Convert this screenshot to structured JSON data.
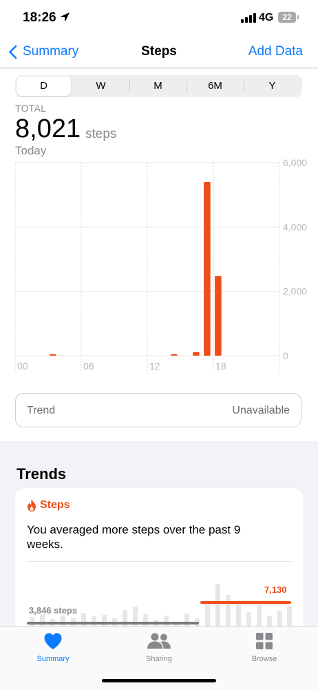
{
  "status": {
    "time": "18:26",
    "network": "4G",
    "battery": "22"
  },
  "nav": {
    "back_label": "Summary",
    "title": "Steps",
    "action_label": "Add Data"
  },
  "range_tabs": [
    {
      "label": "D",
      "selected": true
    },
    {
      "label": "W",
      "selected": false
    },
    {
      "label": "M",
      "selected": false
    },
    {
      "label": "6M",
      "selected": false
    },
    {
      "label": "Y",
      "selected": false
    }
  ],
  "summary": {
    "label": "TOTAL",
    "value": "8,021",
    "unit": "steps",
    "period": "Today"
  },
  "chart_data": {
    "type": "bar",
    "x_ticks": [
      "00",
      "06",
      "12",
      "18"
    ],
    "y_ticks": [
      "6,000",
      "4,000",
      "2,000",
      "0"
    ],
    "ylim": [
      0,
      6000
    ],
    "xlim": [
      0,
      24
    ],
    "bar_color": "#f04e18",
    "bars": [
      {
        "hour": 3,
        "value": 15
      },
      {
        "hour": 14,
        "value": 15
      },
      {
        "hour": 16,
        "value": 110
      },
      {
        "hour": 17,
        "value": 5400
      },
      {
        "hour": 18,
        "value": 2480
      }
    ]
  },
  "trend_row": {
    "label": "Trend",
    "status": "Unavailable"
  },
  "trends": {
    "heading": "Trends",
    "card": {
      "metric": "Steps",
      "message": "You averaged more steps over the past 9 weeks.",
      "old_average_label": "3,846 steps",
      "new_average_label": "7,130",
      "accent_color": "#f04e18"
    }
  },
  "tab_bar": [
    {
      "label": "Summary",
      "icon": "heart-icon",
      "active": true
    },
    {
      "label": "Sharing",
      "icon": "people-icon",
      "active": false
    },
    {
      "label": "Browse",
      "icon": "grid-icon",
      "active": false
    }
  ]
}
